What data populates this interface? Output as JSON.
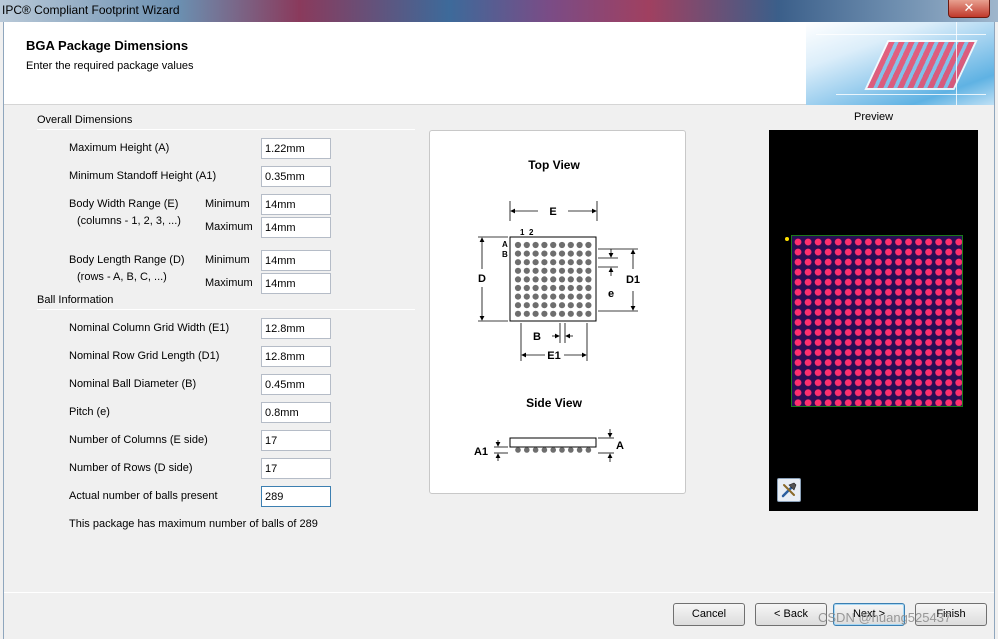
{
  "window": {
    "title": "IPC® Compliant Footprint Wizard",
    "close_glyph": "✕"
  },
  "header": {
    "title": "BGA Package Dimensions",
    "subtitle": "Enter the required package values"
  },
  "overall": {
    "section": "Overall Dimensions",
    "max_height_label": "Maximum Height (A)",
    "max_height": "1.22mm",
    "min_standoff_label": "Minimum Standoff Height (A1)",
    "min_standoff": "0.35mm",
    "body_width_label": "Body Width Range (E)",
    "body_width_sub": "(columns - 1, 2, 3, ...)",
    "body_width_min": "14mm",
    "body_width_max": "14mm",
    "body_length_label": "Body Length Range (D)",
    "body_length_sub": "(rows - A, B, C, ...)",
    "body_length_min": "14mm",
    "body_length_max": "14mm",
    "minimum_label": "Minimum",
    "maximum_label": "Maximum"
  },
  "ball": {
    "section": "Ball Information",
    "col_grid_label": "Nominal Column Grid Width (E1)",
    "col_grid": "12.8mm",
    "row_grid_label": "Nominal Row Grid Length (D1)",
    "row_grid": "12.8mm",
    "ball_diam_label": "Nominal Ball Diameter (B)",
    "ball_diam": "0.45mm",
    "pitch_label": "Pitch (e)",
    "pitch": "0.8mm",
    "num_cols_label": "Number of Columns (E side)",
    "num_cols": "17",
    "num_rows_label": "Number of Rows (D side)",
    "num_rows": "17",
    "actual_balls_label": "Actual number of balls present",
    "actual_balls": "289",
    "max_balls_note": "This package has maximum number of balls of 289"
  },
  "diagram": {
    "top_view": "Top View",
    "side_view": "Side View",
    "E": "E",
    "D": "D",
    "D1": "D1",
    "E1": "E1",
    "B": "B",
    "e": "e",
    "A": "A",
    "A1": "A1",
    "col1": "1",
    "col2": "2",
    "rowA": "A",
    "rowB": "B"
  },
  "preview": {
    "label": "Preview",
    "tool_icon": "wrench-hammer-icon",
    "grid_rows": 17,
    "grid_cols": 17
  },
  "buttons": {
    "cancel": "Cancel",
    "back": "< Back",
    "next": "Next >",
    "finish": "Finish"
  },
  "watermark": "CSDN @huang525437"
}
